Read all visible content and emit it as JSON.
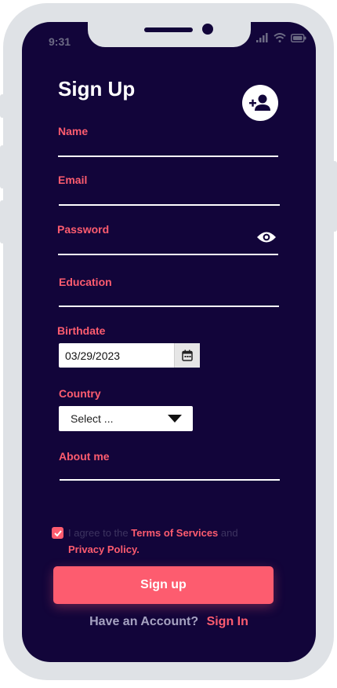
{
  "status_bar": {
    "time": "9:31"
  },
  "header": {
    "title": "Sign Up"
  },
  "form": {
    "name_label": "Name",
    "email_label": "Email",
    "password_label": "Password",
    "education_label": "Education",
    "birthdate_label": "Birthdate",
    "birthdate_value": "03/29/2023",
    "country_label": "Country",
    "country_value": "Select ...",
    "about_label": "About me"
  },
  "agreement": {
    "checked": true,
    "prefix": "I agree to the ",
    "terms_link": "Terms of Services",
    "middle": " and",
    "privacy_link": "Privacy Policy."
  },
  "buttons": {
    "signup_label": "Sign up"
  },
  "footer": {
    "question": "Have an Account?",
    "signin_link": "Sign In"
  },
  "colors": {
    "accent": "#fd5c6f",
    "background": "#12053a",
    "frame": "#dfe2e6"
  },
  "icons": [
    "add-user-icon",
    "eye-icon",
    "calendar-icon",
    "check-icon",
    "signal-icon",
    "wifi-icon",
    "battery-icon"
  ]
}
